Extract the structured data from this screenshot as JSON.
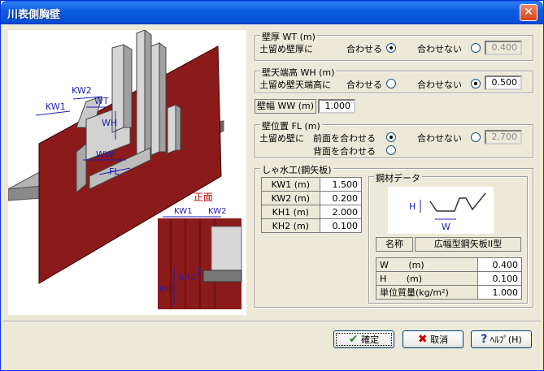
{
  "window": {
    "title": "川表側胸壁"
  },
  "illustration": {
    "labels": {
      "kw1": "KW1",
      "kw2": "KW2",
      "wt": "WT",
      "wh": "WH",
      "ww": "WW",
      "fl": "FL"
    },
    "front_view": {
      "title": "正面",
      "kw1": "KW1",
      "kw2": "KW2",
      "kh2": "KH2",
      "kh1": "KH1"
    }
  },
  "wall_thickness": {
    "legend": "壁厚 WT (m)",
    "row_label": "土留め壁厚に",
    "match_label": "合わせる",
    "nomatch_label": "合わせない",
    "selected": "match",
    "value": "0.400"
  },
  "wall_top_height": {
    "legend": "壁天端高 WH (m)",
    "row_label": "土留め壁天端高に",
    "match_label": "合わせる",
    "nomatch_label": "合わせない",
    "selected": "nomatch",
    "value": "0.500"
  },
  "wall_width": {
    "label": "壁幅 WW (m)",
    "value": "1.000"
  },
  "wall_position": {
    "legend": "壁位置 FL (m)",
    "row_label": "土留め壁に",
    "front_label": "前面を合わせる",
    "back_label": "背面を合わせる",
    "nomatch_label": "合わせない",
    "selected": "front",
    "value": "2.700"
  },
  "sheet_pile": {
    "legend": "しゃ水工(鋼矢板)",
    "rows": [
      {
        "label": "KW1 (m)",
        "value": "1.500"
      },
      {
        "label": "KW2 (m)",
        "value": "0.200"
      },
      {
        "label": "KH1 (m)",
        "value": "2.000"
      },
      {
        "label": "KH2 (m)",
        "value": "0.100"
      }
    ]
  },
  "steel_data": {
    "legend": "鋼材データ",
    "diagram": {
      "h": "H",
      "w": "W"
    },
    "name_label": "名称",
    "name_value": "広幅型鋼矢板II型",
    "rows": [
      {
        "label": "W       (m)",
        "value": "0.400"
      },
      {
        "label": "H       (m)",
        "value": "0.100"
      },
      {
        "label": "単位質量(kg/m²)",
        "value": "1.000"
      }
    ]
  },
  "buttons": {
    "ok": "確定",
    "cancel": "取消",
    "help": "ﾍﾙﾌﾟ(H)"
  },
  "colors": {
    "wall_red": "#8b1a1a",
    "dim_blue": "#1e1eb4",
    "accent_red": "#c80000"
  }
}
